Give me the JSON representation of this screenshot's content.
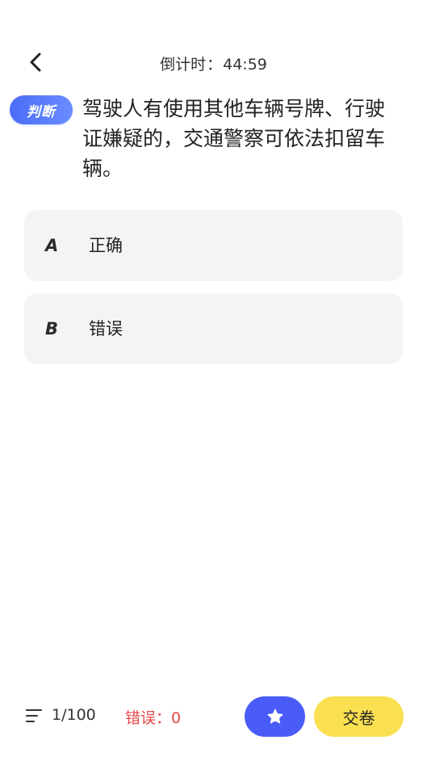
{
  "header": {
    "back_icon": "chevron-left-icon",
    "timer_label": "倒计时",
    "timer_separator": "：",
    "timer_value": "44:59"
  },
  "question": {
    "type_badge": "判断",
    "text": "驾驶人有使用其他车辆号牌、行驶证嫌疑的，交通警察可依法扣留车辆。"
  },
  "options": [
    {
      "letter": "A",
      "text": "正确"
    },
    {
      "letter": "B",
      "text": "错误"
    }
  ],
  "footer": {
    "list_icon": "list-icon",
    "progress": "1/100",
    "errors_label": "错误：",
    "errors_count": "0",
    "favorite_icon": "star-icon",
    "submit_label": "交卷"
  },
  "colors": {
    "accent_blue": "#4a5cf7",
    "submit_yellow": "#fadf50",
    "error_red": "#e84848",
    "option_bg": "#f4f4f4"
  }
}
